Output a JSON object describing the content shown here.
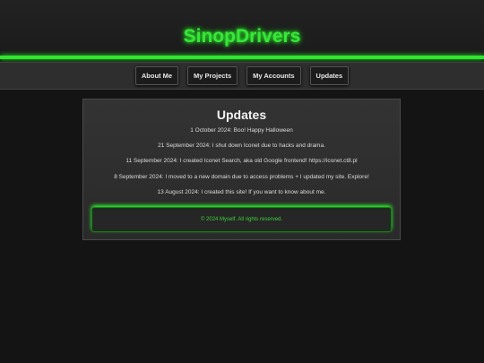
{
  "header": {
    "title": "SinopDrivers"
  },
  "nav": {
    "items": [
      {
        "label": "About Me"
      },
      {
        "label": "My Projects"
      },
      {
        "label": "My Accounts"
      },
      {
        "label": "Updates"
      }
    ]
  },
  "main": {
    "heading": "Updates",
    "updates": [
      "1 October 2024: Boo! Happy Halloween",
      "21 September 2024: I shut down Iconet due to hacks and drama.",
      "11 September 2024: I created Iconet Search, aka old Google frontend! https://iconet.ct8.pl",
      "8 September 2024: I moved to a new domain due to access problems + I updated my site. Explore!",
      "13 August 2024: I created this site! If you want to know about me."
    ]
  },
  "footer": {
    "text": "© 2024 Myself. All rights reserved."
  },
  "colors": {
    "accent": "#39e639",
    "background": "#141414",
    "panel": "#2e2e2e"
  }
}
